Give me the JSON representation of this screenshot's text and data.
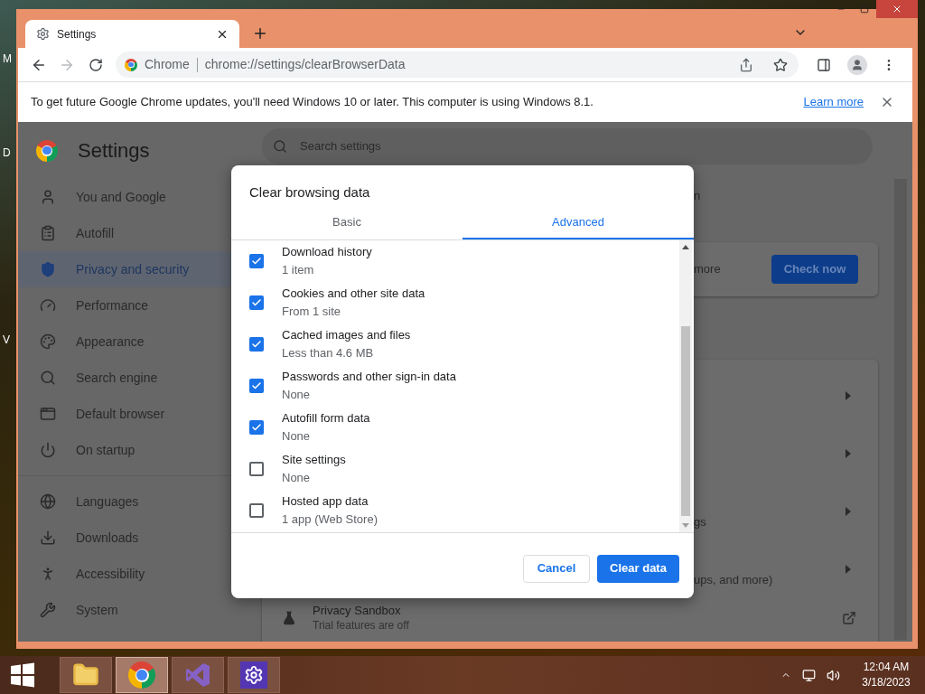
{
  "desktop": {
    "icon_labels": [
      "M",
      "D",
      "V"
    ]
  },
  "browser": {
    "tabs": [
      {
        "title": "Settings",
        "selected": true
      }
    ],
    "forward_enabled": false,
    "omnibox": {
      "chip": "Chrome",
      "url": "chrome://settings/clearBrowserData"
    },
    "infobar": {
      "message": "To get future Google Chrome updates, you'll need Windows 10 or later. This computer is using Windows 8.1.",
      "link": "Learn more"
    }
  },
  "settings": {
    "title": "Settings",
    "search_placeholder": "Search settings",
    "sidebar": [
      [
        {
          "label": "You and Google",
          "selected": false
        },
        {
          "label": "Autofill",
          "selected": false
        },
        {
          "label": "Privacy and security",
          "selected": true
        },
        {
          "label": "Performance",
          "selected": false
        },
        {
          "label": "Appearance",
          "selected": false
        },
        {
          "label": "Search engine",
          "selected": false
        },
        {
          "label": "Default browser",
          "selected": false
        },
        {
          "label": "On startup",
          "selected": false
        }
      ],
      [
        {
          "label": "Languages",
          "selected": false
        },
        {
          "label": "Downloads",
          "selected": false
        },
        {
          "label": "Accessibility",
          "selected": false
        },
        {
          "label": "System",
          "selected": false
        }
      ]
    ],
    "top_fragment": "n",
    "safety_check": {
      "fragment": "more",
      "button": "Check now"
    },
    "rows": [
      {
        "kind": "submenu"
      },
      {
        "kind": "submenu"
      },
      {
        "kind": "submenu",
        "fragment": "gs"
      },
      {
        "kind": "submenu",
        "fragment": "ups, and more)"
      },
      {
        "kind": "external",
        "title": "Privacy Sandbox",
        "subtitle": "Trial features are off"
      }
    ]
  },
  "dialog": {
    "title": "Clear browsing data",
    "tabs": [
      {
        "label": "Basic",
        "selected": false
      },
      {
        "label": "Advanced",
        "selected": true
      }
    ],
    "items": [
      {
        "label": "Download history",
        "detail": "1 item",
        "checked": true
      },
      {
        "label": "Cookies and other site data",
        "detail": "From 1 site",
        "checked": true
      },
      {
        "label": "Cached images and files",
        "detail": "Less than 4.6 MB",
        "checked": true
      },
      {
        "label": "Passwords and other sign-in data",
        "detail": "None",
        "checked": true
      },
      {
        "label": "Autofill form data",
        "detail": "None",
        "checked": true
      },
      {
        "label": "Site settings",
        "detail": "None",
        "checked": false
      },
      {
        "label": "Hosted app data",
        "detail": "1 app (Web Store)",
        "checked": false
      }
    ],
    "cancel": "Cancel",
    "confirm": "Clear data"
  },
  "taskbar": {
    "apps": [
      {
        "kind": "files",
        "selected": false
      },
      {
        "kind": "chrome",
        "selected": true
      },
      {
        "kind": "studio",
        "selected": false
      },
      {
        "kind": "settings",
        "selected": false
      }
    ],
    "time": "12:04 AM",
    "date": "3/18/2023"
  }
}
